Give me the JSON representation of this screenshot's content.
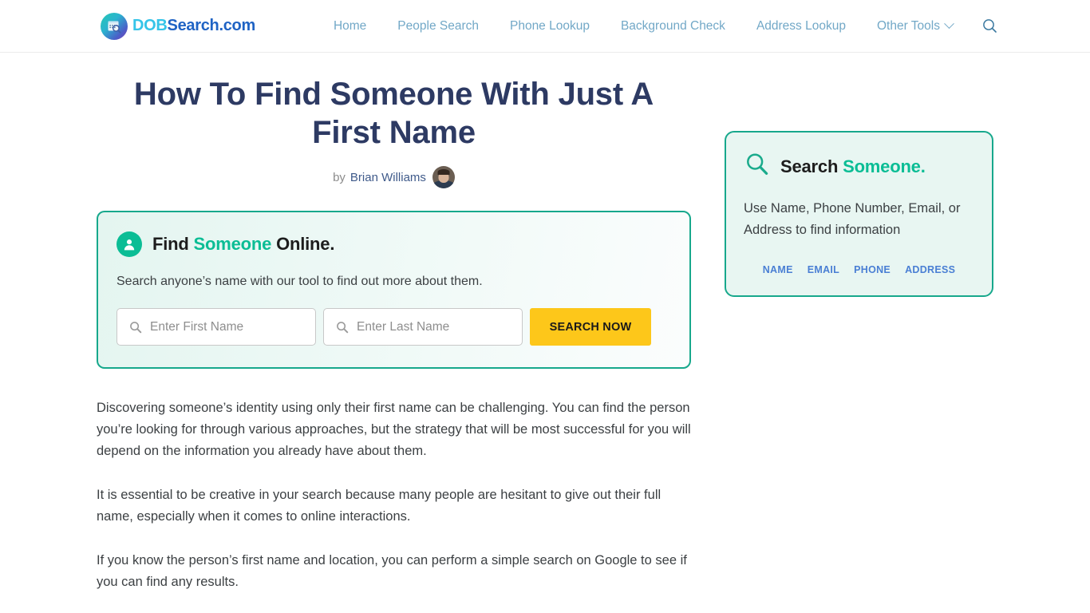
{
  "header": {
    "logo": {
      "icon": "calendar-magnifier-icon",
      "text_primary": "DOB",
      "text_secondary": "Search.com"
    },
    "nav": [
      {
        "label": "Home",
        "icon": null
      },
      {
        "label": "People Search",
        "icon": null
      },
      {
        "label": "Phone Lookup",
        "icon": null
      },
      {
        "label": "Background Check",
        "icon": null
      },
      {
        "label": "Address Lookup",
        "icon": null
      },
      {
        "label": "Other Tools",
        "icon": "chevron-down-icon"
      }
    ],
    "search_icon": "search-icon"
  },
  "article": {
    "title": "How To Find Someone With Just A First Name",
    "byline": {
      "prefix": "by",
      "author": "Brian Williams",
      "avatar": "author-avatar"
    },
    "paragraphs": [
      "Discovering someone’s identity using only their first name can be challenging. You can find the person you’re looking for through various approaches, but the strategy that will be most successful for you will depend on the information you already have about them.",
      "It is essential to be creative in your search because many people are hesitant to give out their full name, especially when it comes to online interactions.",
      "If you know the person’s first name and location, you can perform a simple search on Google to see if you can find any results."
    ]
  },
  "search_panel": {
    "icon": "person-circle-icon",
    "title_part1": "Find ",
    "title_accent": "Someone",
    "title_part3": " Online.",
    "subtitle": "Search anyone’s name with our tool to find out more about them.",
    "first_name": {
      "value": "",
      "placeholder": "Enter First Name",
      "icon": "search-icon"
    },
    "last_name": {
      "value": "",
      "placeholder": "Enter Last Name",
      "icon": "search-icon"
    },
    "button_label": "SEARCH NOW"
  },
  "sidebar": {
    "widget": {
      "icon": "magnifier-outline-icon",
      "title_part1": "Search ",
      "title_accent": "Someone.",
      "description": "Use Name, Phone Number, Email, or Address to find information",
      "tabs": [
        {
          "label": "NAME"
        },
        {
          "label": "EMAIL"
        },
        {
          "label": "PHONE"
        },
        {
          "label": "ADDRESS"
        }
      ]
    }
  },
  "colors": {
    "teal": "#0bbd95",
    "teal_border": "#17a88c",
    "yellow": "#fdc71a",
    "nav_blue": "#72a8c7",
    "title_navy": "#2d3a63",
    "tab_blue": "#4a7fd4",
    "logo_cyan": "#35c4e8",
    "logo_blue": "#1f63c4"
  }
}
